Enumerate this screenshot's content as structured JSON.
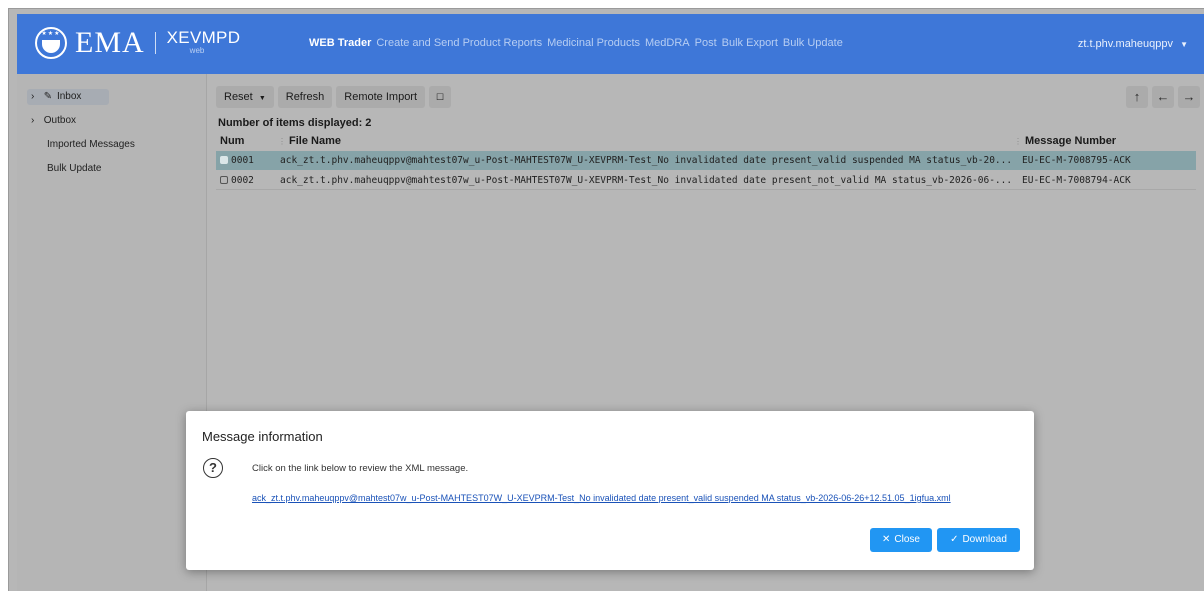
{
  "header": {
    "logo_text": "EMA",
    "product": "XEVMPD",
    "product_sub": "web",
    "nav": [
      {
        "label": "WEB Trader",
        "active": true
      },
      {
        "label": "Create and Send Product Reports",
        "active": false
      },
      {
        "label": "Medicinal Products",
        "active": false
      },
      {
        "label": "MedDRA",
        "active": false
      },
      {
        "label": "Post",
        "active": false
      },
      {
        "label": "Bulk Export",
        "active": false
      },
      {
        "label": "Bulk Update",
        "active": false
      }
    ],
    "user": "zt.t.phv.maheuqppv"
  },
  "sidebar": {
    "items": [
      {
        "label": "Inbox",
        "selected": true
      },
      {
        "label": "Outbox"
      },
      {
        "label": "Imported Messages"
      },
      {
        "label": "Bulk Update"
      }
    ]
  },
  "toolbar": {
    "reset_label": "Reset",
    "refresh_label": "Refresh",
    "remote_import_label": "Remote Import"
  },
  "list": {
    "count_label": "Number of items displayed: 2",
    "columns": [
      "Num",
      "File Name",
      "Message Number"
    ],
    "rows": [
      {
        "num": "0001",
        "file_name": "ack_zt.t.phv.maheuqppv@mahtest07w_u-Post-MAHTEST07W_U-XEVPRM-Test_No invalidated date present_valid suspended MA status_vb-20...",
        "message_number": "EU-EC-M-7008795-ACK",
        "selected": true
      },
      {
        "num": "0002",
        "file_name": "ack_zt.t.phv.maheuqppv@mahtest07w_u-Post-MAHTEST07W_U-XEVPRM-Test_No invalidated date present_not_valid MA status_vb-2026-06-...",
        "message_number": "EU-EC-M-7008794-ACK",
        "selected": false
      }
    ]
  },
  "modal": {
    "title": "Message information",
    "icon": "question-circle-icon",
    "text": "Click on the link below to review the XML message.",
    "link": "ack_zt.t.phv.maheuqppv@mahtest07w_u-Post-MAHTEST07W_U-XEVPRM-Test_No invalidated date present_valid suspended MA status_vb-2026-06-26+12.51.05_1igfua.xml",
    "close_label": "Close",
    "download_label": "Download"
  },
  "colors": {
    "header_bg": "#3e77d8",
    "button_primary": "#2196f3",
    "row_selected": "#86a3a8"
  }
}
